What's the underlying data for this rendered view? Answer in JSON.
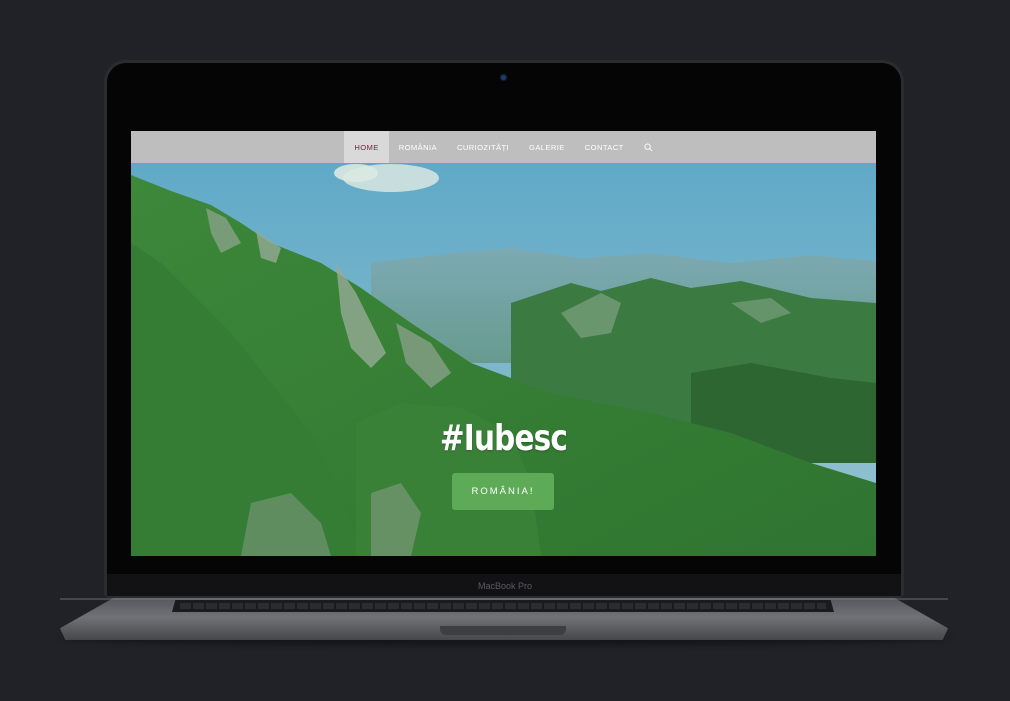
{
  "device": {
    "brand_label": "MacBook Pro"
  },
  "nav": {
    "items": [
      {
        "label": "HOME",
        "active": true
      },
      {
        "label": "ROMÂNIA",
        "active": false
      },
      {
        "label": "CURIOZITĂȚI",
        "active": false
      },
      {
        "label": "GALERIE",
        "active": false
      },
      {
        "label": "CONTACT",
        "active": false
      }
    ],
    "search_icon": "search-icon",
    "active_color": "#8b1a3d",
    "bar_color": "#bebebe"
  },
  "hero": {
    "headline": "#Iubesc",
    "cta_label": "ROMÂNIA!",
    "cta_color": "#5dab57"
  }
}
